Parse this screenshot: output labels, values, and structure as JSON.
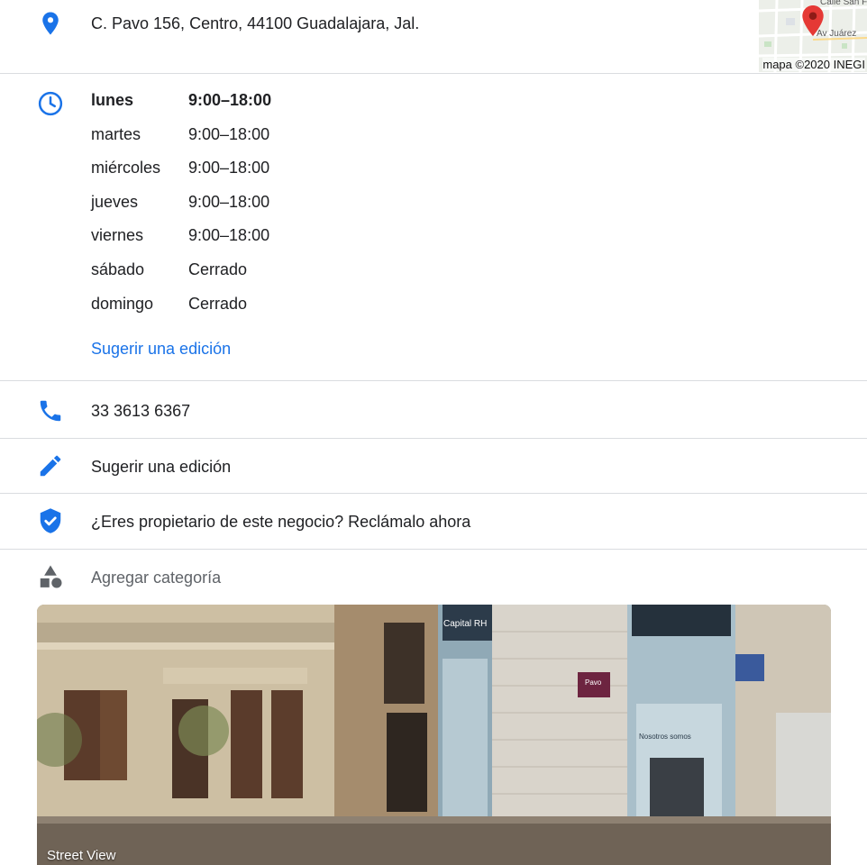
{
  "address": {
    "text": "C. Pavo 156, Centro, 44100 Guadalajara, Jal.",
    "icon": "location-pin-icon"
  },
  "map": {
    "street_labels": [
      "Calle San F",
      "Av Juárez"
    ],
    "credit": "mapa ©2020 INEGI",
    "pin_color": "#e53935"
  },
  "hours": {
    "icon": "clock-icon",
    "days": [
      {
        "day": "lunes",
        "time": "9:00–18:00"
      },
      {
        "day": "martes",
        "time": "9:00–18:00"
      },
      {
        "day": "miércoles",
        "time": "9:00–18:00"
      },
      {
        "day": "jueves",
        "time": "9:00–18:00"
      },
      {
        "day": "viernes",
        "time": "9:00–18:00"
      },
      {
        "day": "sábado",
        "time": "Cerrado"
      },
      {
        "day": "domingo",
        "time": "Cerrado"
      }
    ],
    "suggest_label": "Sugerir una edición"
  },
  "phone": {
    "text": "33 3613 6367",
    "icon": "phone-icon"
  },
  "suggest_edit": {
    "text": "Sugerir una edición",
    "icon": "pencil-icon"
  },
  "claim": {
    "text": "¿Eres propietario de este negocio? Reclámalo ahora",
    "icon": "verified-shield-icon"
  },
  "category": {
    "text": "Agregar categoría",
    "icon": "category-shapes-icon"
  },
  "street_view": {
    "label": "Street View",
    "signs": [
      "Capital RH",
      "Pavo",
      "Nosotros somos"
    ]
  },
  "colors": {
    "accent": "#1a73e8",
    "divider": "#dadce0",
    "muted": "#5f6368"
  }
}
